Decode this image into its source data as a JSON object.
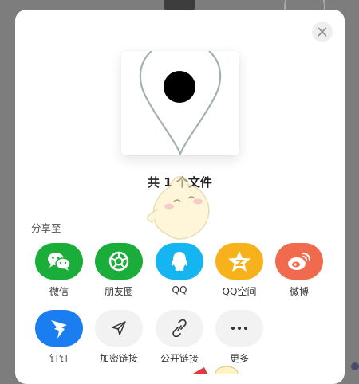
{
  "file_count_text": "共 1 个文件",
  "section_label": "分享至",
  "share_row1": [
    {
      "label": "微信",
      "icon": "wechat-icon",
      "color": "#1aad3a"
    },
    {
      "label": "朋友圈",
      "icon": "moments-icon",
      "color": "#1aad3a"
    },
    {
      "label": "QQ",
      "icon": "qq-icon",
      "color": "#15b5f2"
    },
    {
      "label": "QQ空间",
      "icon": "qzone-icon",
      "color": "#f7b11a"
    },
    {
      "label": "微博",
      "icon": "weibo-icon",
      "color": "#f06a4e"
    }
  ],
  "share_row2": [
    {
      "label": "钉钉",
      "icon": "dingtalk-icon",
      "color": "#1a7ef0"
    },
    {
      "label": "加密链接",
      "icon": "send-icon",
      "color": "#f2f2f2"
    },
    {
      "label": "公开链接",
      "icon": "link-icon",
      "color": "#f2f2f2"
    },
    {
      "label": "更多",
      "icon": "more-icon",
      "color": "#f2f2f2"
    }
  ]
}
